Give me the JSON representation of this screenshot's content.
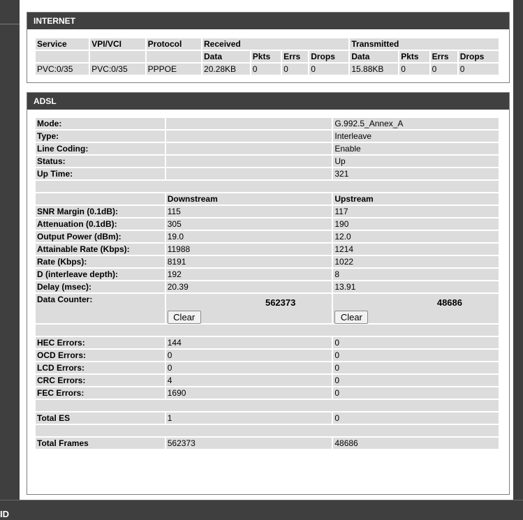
{
  "footer": {
    "text": "ID"
  },
  "internet": {
    "title": "INTERNET",
    "headers": {
      "service": "Service",
      "vpivci": "VPI/VCI",
      "protocol": "Protocol",
      "received": "Received",
      "transmitted": "Transmitted"
    },
    "subheaders": [
      "Data",
      "Pkts",
      "Errs",
      "Drops",
      "Data",
      "Pkts",
      "Errs",
      "Drops"
    ],
    "row": [
      "PVC:0/35",
      "PVC:0/35",
      "PPPOE",
      "20.28KB",
      "0",
      "0",
      "0",
      "15.88KB",
      "0",
      "0",
      "0"
    ]
  },
  "adsl": {
    "title": "ADSL",
    "info": [
      {
        "label": "Mode:",
        "value": "G.992.5_Annex_A"
      },
      {
        "label": "Type:",
        "value": "Interleave"
      },
      {
        "label": "Line Coding:",
        "value": "Enable"
      },
      {
        "label": "Status:",
        "value": "Up"
      },
      {
        "label": "Up Time:",
        "value": "321"
      }
    ],
    "col_down": "Downstream",
    "col_up": "Upstream",
    "stats": [
      {
        "label": "SNR Margin (0.1dB):",
        "down": "115",
        "up": "117"
      },
      {
        "label": "Attenuation (0.1dB):",
        "down": "305",
        "up": "190"
      },
      {
        "label": "Output Power (dBm):",
        "down": "19.0",
        "up": "12.0"
      },
      {
        "label": "Attainable Rate (Kbps):",
        "down": "11988",
        "up": "1214"
      },
      {
        "label": "Rate (Kbps):",
        "down": "8191",
        "up": "1022"
      },
      {
        "label": "D (interleave depth):",
        "down": "192",
        "up": "8"
      },
      {
        "label": "Delay (msec):",
        "down": "20.39",
        "up": "13.91"
      }
    ],
    "data_counter": {
      "label": "Data Counter:",
      "down": "562373",
      "up": "48686",
      "clear_label": "Clear"
    },
    "errors": [
      {
        "label": "HEC Errors:",
        "down": "144",
        "up": "0"
      },
      {
        "label": "OCD Errors:",
        "down": "0",
        "up": "0"
      },
      {
        "label": "LCD Errors:",
        "down": "0",
        "up": "0"
      },
      {
        "label": "CRC Errors:",
        "down": "4",
        "up": "0"
      },
      {
        "label": "FEC Errors:",
        "down": "1690",
        "up": "0"
      }
    ],
    "total_es": {
      "label": "Total ES",
      "down": "1",
      "up": "0"
    },
    "total_frames": {
      "label": "Total Frames",
      "down": "562373",
      "up": "48686"
    }
  }
}
